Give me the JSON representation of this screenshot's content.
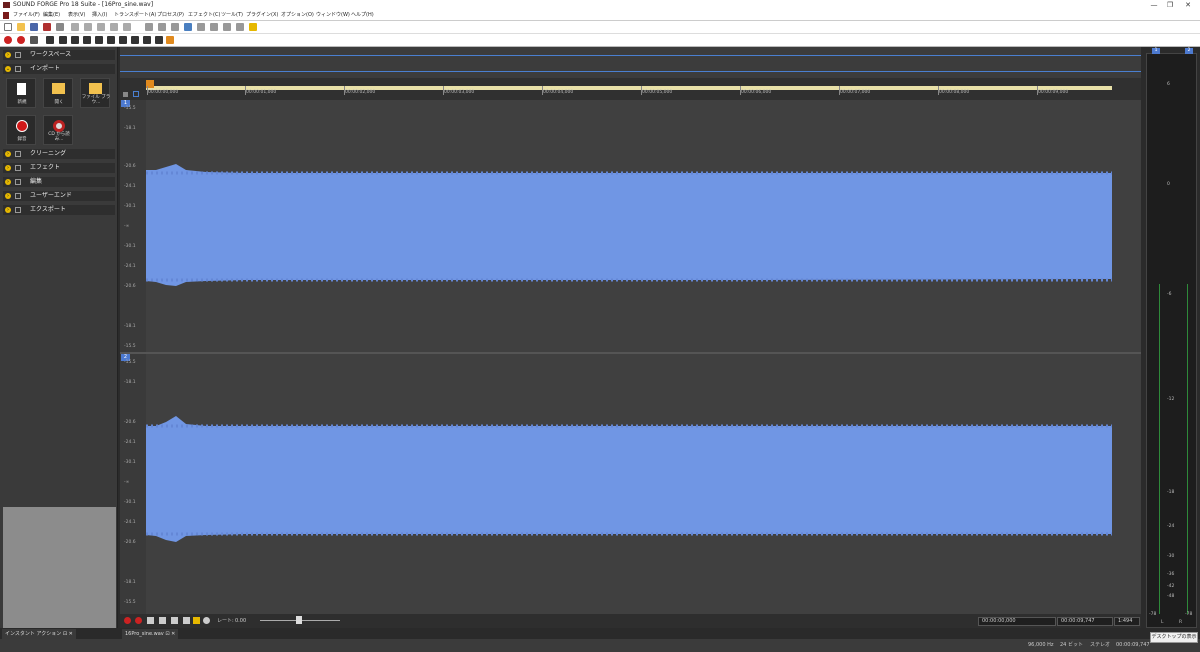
{
  "title_bar": {
    "text": "SOUND FORGE Pro 18 Suite - [16Pro_sine.wav]"
  },
  "menu": [
    "ファイル(F)",
    "編集(E)",
    "表示(V)",
    "挿入(I)",
    "トランスポート(A)",
    "プロセス(P)",
    "エフェクト(C)",
    "ツール(T)",
    "プラグイン(X)",
    "オプション(O)",
    "ウィンドウ(W)",
    "ヘルプ(H)"
  ],
  "left_panel": {
    "sections": [
      {
        "label": "ワークスペース",
        "icon": "workspace-icon"
      },
      {
        "label": "インポート",
        "icon": "import-icon"
      },
      {
        "label": "クリーニング",
        "icon": "cleaning-icon"
      },
      {
        "label": "エフェクト",
        "icon": "effects-icon"
      },
      {
        "label": "編集",
        "icon": "edit-icon"
      },
      {
        "label": "ユーザーエンド",
        "icon": "user-icon"
      },
      {
        "label": "エクスポート",
        "icon": "export-icon"
      }
    ],
    "import_tiles": [
      "新規",
      "開く",
      "ファイル ブラウ..."
    ],
    "record_tiles": [
      "録音",
      "CD から読み..."
    ]
  },
  "ruler": {
    "ticks": [
      "00:00:00,000",
      "00:00:01,000",
      "00:00:02,000",
      "00:00:03,000",
      "00:00:04,000",
      "00:00:05,000",
      "00:00:06,000",
      "00:00:07,000",
      "00:00:08,000",
      "00:00:09,000"
    ]
  },
  "channels": [
    {
      "num": "1",
      "db_labels": [
        "-15.5",
        "-18.1",
        "-20.6",
        "-24.1",
        "-30.1",
        "-∞",
        "-30.1",
        "-24.1",
        "-20.6",
        "-18.1",
        "-15.5"
      ]
    },
    {
      "num": "2",
      "db_labels": [
        "-15.5",
        "-18.1",
        "-20.6",
        "-24.1",
        "-30.1",
        "-∞",
        "-30.1",
        "-24.1",
        "-20.6",
        "-18.1",
        "-15.5"
      ]
    }
  ],
  "transport": {
    "rate_label": "レート:",
    "rate_value": "0.00",
    "time_start": "00:00:00,000",
    "time_end": "00:00:09,747",
    "zoom": "1:494"
  },
  "meter": {
    "ch_labels": [
      "1",
      "2"
    ],
    "scale": [
      "6",
      "0",
      "-6",
      "-12",
      "-18",
      "-24",
      "-30",
      "-36",
      "-42",
      "-48",
      "-54",
      "-60",
      "-66",
      "-72",
      "-78"
    ],
    "footer": [
      "-78",
      "L",
      "R",
      "-78"
    ]
  },
  "bottom_tabs": {
    "left": "インスタント アクション",
    "doc": "16Pro_sine.wav"
  },
  "status": {
    "sample_rate": "96,000 Hz",
    "bit_depth": "24 ビット",
    "channels": "ステレオ",
    "length": "00:00:09,747"
  },
  "tooltip": "デスクトップの表示",
  "colors": {
    "waveform": "#7096e4",
    "background": "#404040",
    "accent": "#e6b800"
  }
}
